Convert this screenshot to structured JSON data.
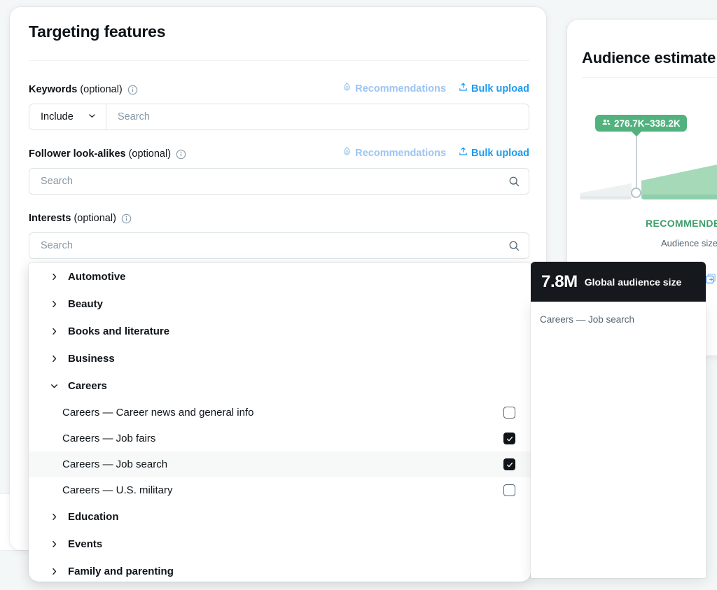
{
  "targeting": {
    "title": "Targeting features",
    "keywords": {
      "label": "Keywords",
      "optional": "(optional)",
      "recommendations_label": "Recommendations",
      "bulk_upload_label": "Bulk upload",
      "include_value": "Include",
      "search_placeholder": "Search",
      "search_value": ""
    },
    "follower_lookalikes": {
      "label": "Follower look-alikes",
      "optional": "(optional)",
      "recommendations_label": "Recommendations",
      "bulk_upload_label": "Bulk upload",
      "search_placeholder": "Search",
      "search_value": ""
    },
    "interests": {
      "label": "Interests",
      "optional": "(optional)",
      "search_placeholder": "Search",
      "search_value": ""
    }
  },
  "interests_list": [
    {
      "kind": "category",
      "label": "Automotive",
      "expanded": false
    },
    {
      "kind": "category",
      "label": "Beauty",
      "expanded": false
    },
    {
      "kind": "category",
      "label": "Books and literature",
      "expanded": false
    },
    {
      "kind": "category",
      "label": "Business",
      "expanded": false
    },
    {
      "kind": "category",
      "label": "Careers",
      "expanded": true
    },
    {
      "kind": "item",
      "label": "Careers — Career news and general info",
      "checked": false,
      "hovered": false
    },
    {
      "kind": "item",
      "label": "Careers — Job fairs",
      "checked": true,
      "hovered": false
    },
    {
      "kind": "item",
      "label": "Careers — Job search",
      "checked": true,
      "hovered": true
    },
    {
      "kind": "item",
      "label": "Careers — U.S. military",
      "checked": false,
      "hovered": false
    },
    {
      "kind": "category",
      "label": "Education",
      "expanded": false
    },
    {
      "kind": "category",
      "label": "Events",
      "expanded": false
    },
    {
      "kind": "category",
      "label": "Family and parenting",
      "expanded": false
    }
  ],
  "audience": {
    "title": "Audience estimate",
    "range_badge": "276.7K–338.2K",
    "recommended_label": "RECOMMENDED",
    "size_label": "Audience size",
    "badge_color": "#52b27e",
    "recommended_color": "#3e9e6a",
    "wedge_color": "#a5d9b8"
  },
  "tooltip": {
    "value": "7.8M",
    "caption": "Global audience size",
    "item": "Careers — Job search"
  }
}
